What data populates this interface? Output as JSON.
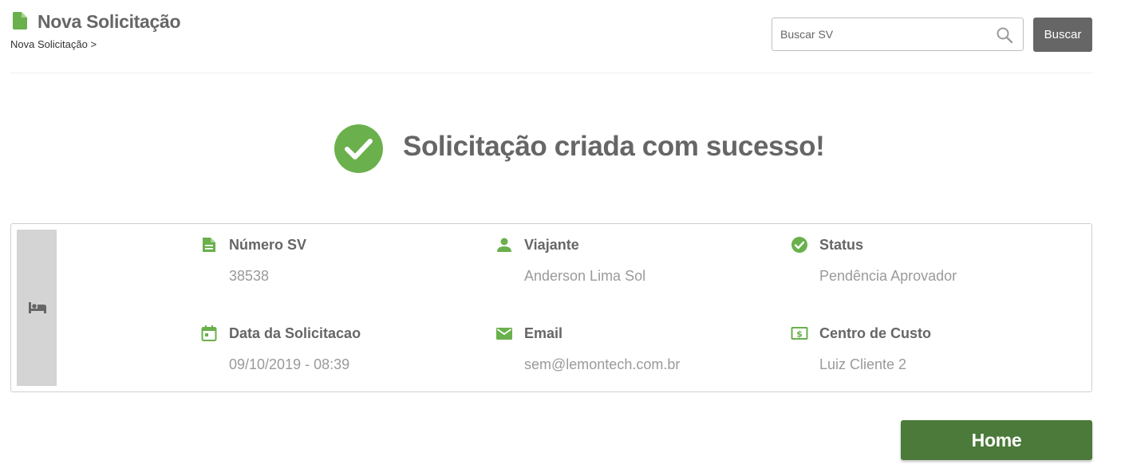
{
  "header": {
    "icon": "document-icon",
    "title": "Nova Solicitação",
    "breadcrumb": "Nova Solicitação >"
  },
  "search": {
    "placeholder": "Buscar SV",
    "value": "",
    "button_label": "Buscar",
    "icon": "search-icon"
  },
  "success": {
    "icon": "check-circle-icon",
    "message": "Solicitação criada com sucesso!"
  },
  "details": {
    "service_icon": "hotel-bed-icon",
    "fields": [
      {
        "icon": "document-icon",
        "label": "Número SV",
        "value": "38538"
      },
      {
        "icon": "person-icon",
        "label": "Viajante",
        "value": "Anderson Lima Sol"
      },
      {
        "icon": "check-circle-icon",
        "label": "Status",
        "value": "Pendência Aprovador"
      },
      {
        "icon": "calendar-icon",
        "label": "Data da Solicitacao",
        "value": "09/10/2019 - 08:39"
      },
      {
        "icon": "email-icon",
        "label": "Email",
        "value": "sem@lemontech.com.br"
      },
      {
        "icon": "money-icon",
        "label": "Centro de Custo",
        "value": "Luiz Cliente 2"
      }
    ]
  },
  "home_button": {
    "label": "Home"
  },
  "colors": {
    "accent_green": "#6ab04c",
    "home_button": "#4b7a3a",
    "search_button": "#666666",
    "text": "#666666",
    "muted_text": "#9a9a9a"
  }
}
